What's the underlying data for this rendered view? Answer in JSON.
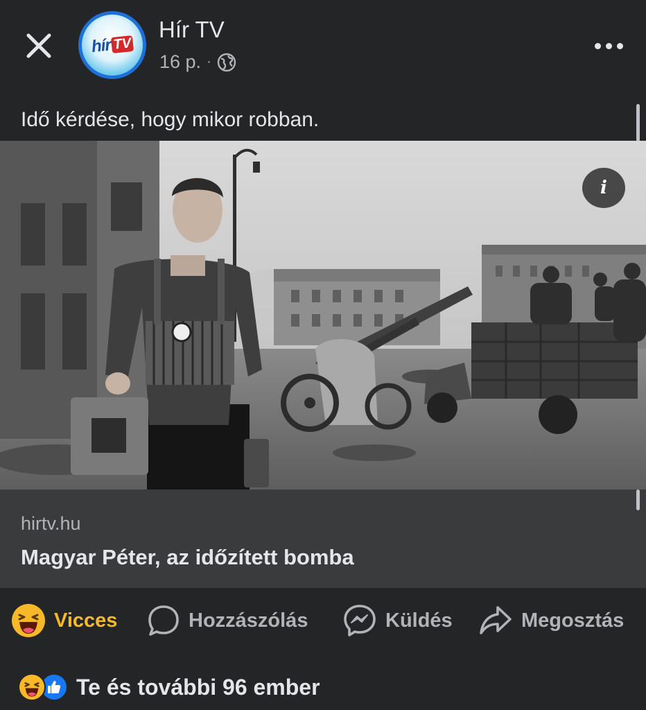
{
  "header": {
    "page_name": "Hír TV",
    "logo_text_left": "hír",
    "logo_text_right": "TV",
    "timestamp": "16 p.",
    "separator": "·",
    "audience_icon": "globe-icon",
    "close_icon": "close-icon",
    "more_icon": "more-options-icon"
  },
  "post": {
    "caption": "Idő kérdése, hogy mikor robban.",
    "info_label": "i"
  },
  "link_card": {
    "domain": "hirtv.hu",
    "title": "Magyar Péter, az időzített bomba"
  },
  "actions": [
    {
      "label": "Vicces",
      "icon": "haha-reaction-icon",
      "active": true
    },
    {
      "label": "Hozzászólás",
      "icon": "comment-icon",
      "active": false
    },
    {
      "label": "Küldés",
      "icon": "messenger-icon",
      "active": false
    },
    {
      "label": "Megosztás",
      "icon": "share-icon",
      "active": false
    }
  ],
  "summary": {
    "text": "Te és további 96 ember",
    "reaction_icons": [
      "haha-reaction-icon",
      "like-reaction-icon"
    ]
  },
  "colors": {
    "background": "#242526",
    "card": "#3a3b3c",
    "text_primary": "#e4e6eb",
    "text_secondary": "#b0b3b8",
    "haha_active": "#f7b928",
    "like_blue": "#1877f2",
    "avatar_ring": "#1e6fd8"
  }
}
